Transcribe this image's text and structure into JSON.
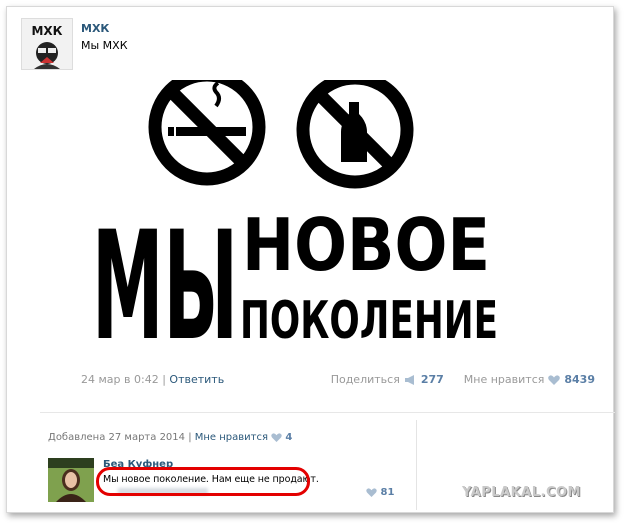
{
  "post": {
    "author": "МХК",
    "text": "Мы МХК",
    "avatar_text": "МХК",
    "poster": {
      "big_word": "МЫ",
      "line1": "НОВОЕ",
      "line2": "ПОКОЛЕНИЕ"
    },
    "date": "24 мар в 0:42",
    "separator": "|",
    "reply_label": "Ответить",
    "share_label": "Поделиться",
    "share_count": "277",
    "like_label": "Мне нравится",
    "like_count": "8439"
  },
  "comment": {
    "added_text": "Добавлена 27 марта 2014",
    "separator": "|",
    "like_label": "Мне нравится",
    "like_count": "4",
    "author": "Беа Куфнер",
    "text": "Мы новое поколение. Нам еще не продают.",
    "likes": "81"
  },
  "watermark": "YAPLAKAL.COM",
  "colors": {
    "link": "#2b587a",
    "highlight": "#e30000",
    "count": "#5b7fa6"
  }
}
